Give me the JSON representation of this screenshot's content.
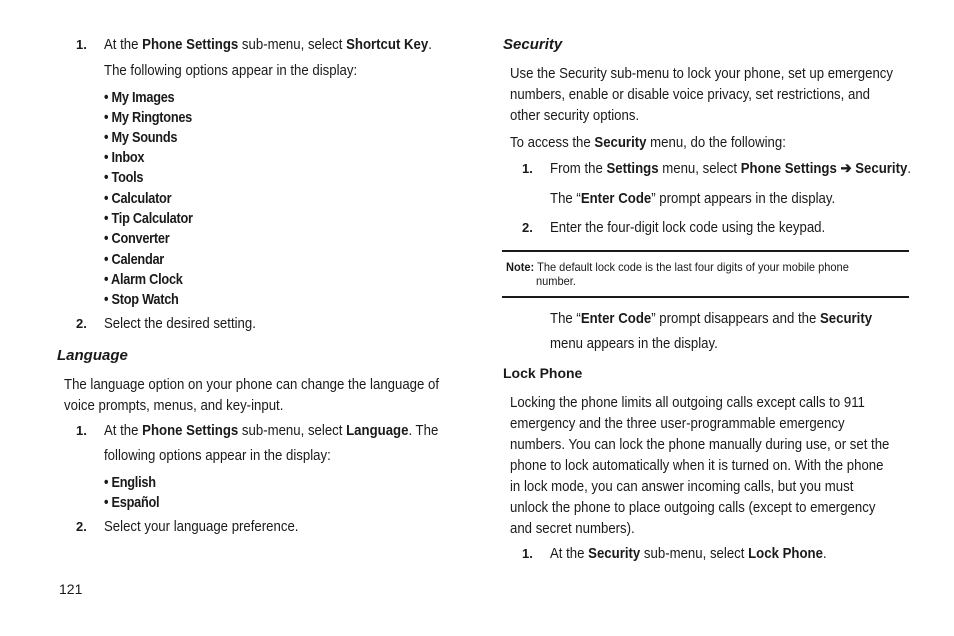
{
  "left_column": {
    "step1": {
      "number": "1.",
      "pre": "At the ",
      "b1": "Phone Settings",
      "mid": " sub-menu, select ",
      "b2": "Shortcut Key",
      "post": ".",
      "following": "The following options appear in the display:"
    },
    "shortcut_options": [
      "• My Images",
      "• My Ringtones",
      "• My Sounds",
      "• Inbox",
      "• Tools",
      "• Calculator",
      "• Tip Calculator",
      "• Converter",
      "• Calendar",
      "• Alarm Clock",
      "• Stop Watch"
    ],
    "step2": {
      "number": "2.",
      "text": "Select the desired setting."
    },
    "language": {
      "heading": "Language",
      "intro_line1": "The language option on your phone can change the language of",
      "intro_line2": "voice prompts, menus, and key-input.",
      "step1": {
        "number": "1.",
        "pre": "At the ",
        "b1": "Phone Settings",
        "mid": " sub-menu, select ",
        "b2": "Language",
        "post": ". The",
        "line2": "following options appear in the display:"
      },
      "options": [
        "• English",
        "• Español"
      ],
      "step2": {
        "number": "2.",
        "text": "Select your language preference."
      }
    }
  },
  "right_column": {
    "security": {
      "heading": "Security",
      "intro_line1": "Use the Security sub-menu to lock your phone, set up emergency",
      "intro_line2": "numbers, enable or disable voice privacy, set restrictions, and",
      "intro_line3": "other security options.",
      "access": {
        "pre": "To access the ",
        "b": "Security",
        "post": " menu, do the following:"
      },
      "step1": {
        "number": "1.",
        "pre": "From the ",
        "b1": "Settings",
        "mid": " menu, select ",
        "b2": "Phone Settings ➔ Security",
        "post": ".",
        "prompt_pre": "The “",
        "prompt_b": "Enter Code",
        "prompt_post": "” prompt appears in the display."
      },
      "step2": {
        "number": "2.",
        "text": "Enter the four-digit lock code using the keypad."
      },
      "note": {
        "label": "Note:",
        "line1": " The default lock code is the last four digits of your mobile phone",
        "line2": "number."
      },
      "after_note": {
        "pre": "The “",
        "b1": "Enter Code",
        "mid": "” prompt disappears and the ",
        "b2": "Security",
        "line2": "menu appears in the display."
      }
    },
    "lock_phone": {
      "heading": "Lock Phone",
      "lines": [
        "Locking the phone limits all outgoing calls except calls to 911",
        "emergency and the three user-programmable emergency",
        "numbers. You can lock the phone manually during use, or set the",
        "phone to lock automatically when it is turned on. With the phone",
        "in lock mode, you can answer incoming calls, but you must",
        "unlock the phone to place outgoing calls (except to emergency",
        "and secret numbers)."
      ],
      "step1": {
        "number": "1.",
        "pre": "At the ",
        "b1": "Security",
        "mid": " sub-menu, select ",
        "b2": "Lock Phone",
        "post": "."
      }
    }
  },
  "footer": {
    "page_number": "121"
  }
}
